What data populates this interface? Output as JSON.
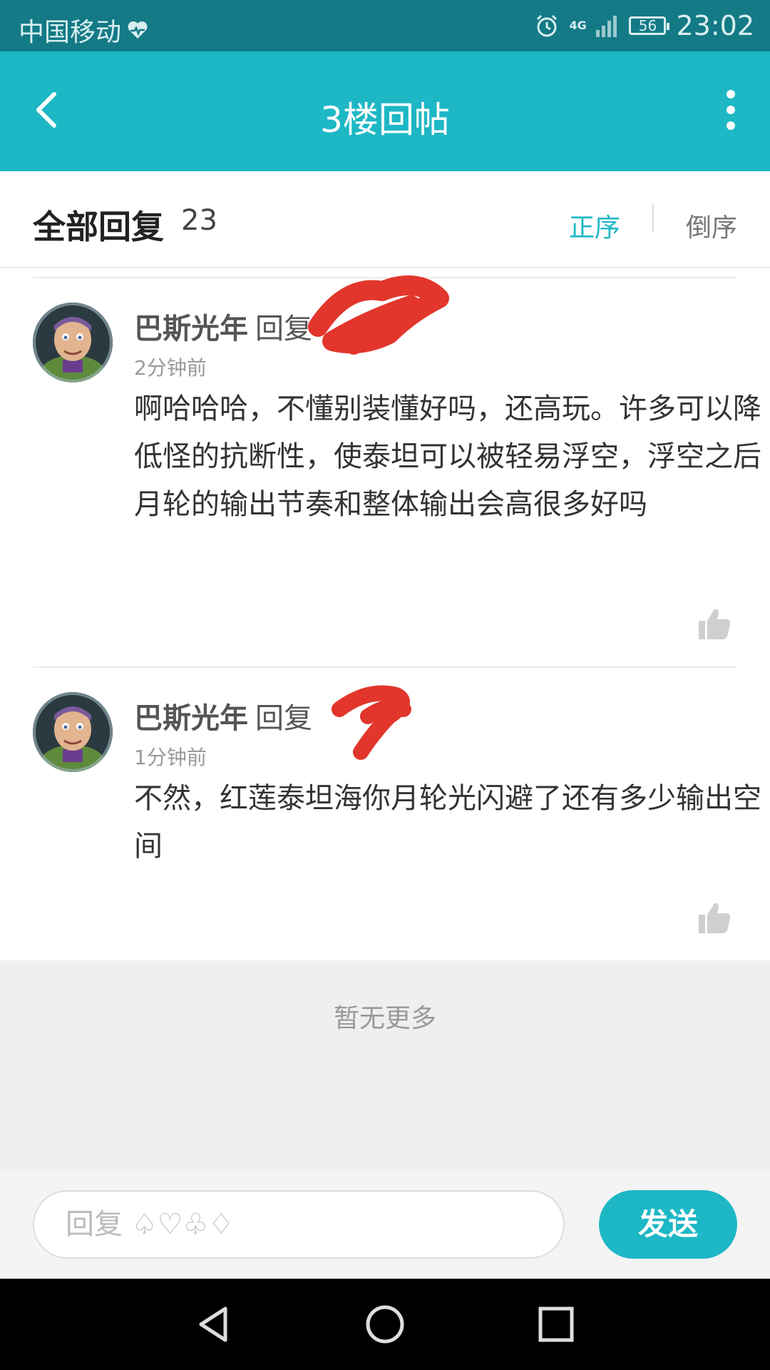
{
  "status_bar": {
    "carrier": "中国移动",
    "network": "4G",
    "battery": "56",
    "time": "23:02"
  },
  "app_bar": {
    "title": "3楼回帖"
  },
  "replies_header": {
    "title": "全部回复",
    "count": "23",
    "sort_asc": "正序",
    "sort_desc": "倒序"
  },
  "comments": [
    {
      "author": "巴斯光年",
      "reply_label": "回复",
      "time": "2分钟前",
      "body": "啊哈哈哈，不懂别装懂好吗，还高玩。许多可以降低怪的抗断性，使泰坦可以被轻易浮空，浮空之后月轮的输出节奏和整体输出会高很多好吗"
    },
    {
      "author": "巴斯光年",
      "reply_label": "回复",
      "time": "1分钟前",
      "body": "不然，红莲泰坦海你月轮光闪避了还有多少输出空间"
    }
  ],
  "no_more": "暂无更多",
  "compose": {
    "placeholder": "回复 ♤♡♧♢",
    "send_label": "发送"
  },
  "colors": {
    "accent": "#1db7c5",
    "status_bar": "#137a86"
  },
  "icons": {
    "back": "back-arrow-icon",
    "more": "more-vertical-icon",
    "like": "thumbs-up-icon",
    "nav_back": "triangle-back-icon",
    "nav_home": "circle-home-icon",
    "nav_recent": "square-recent-icon"
  }
}
